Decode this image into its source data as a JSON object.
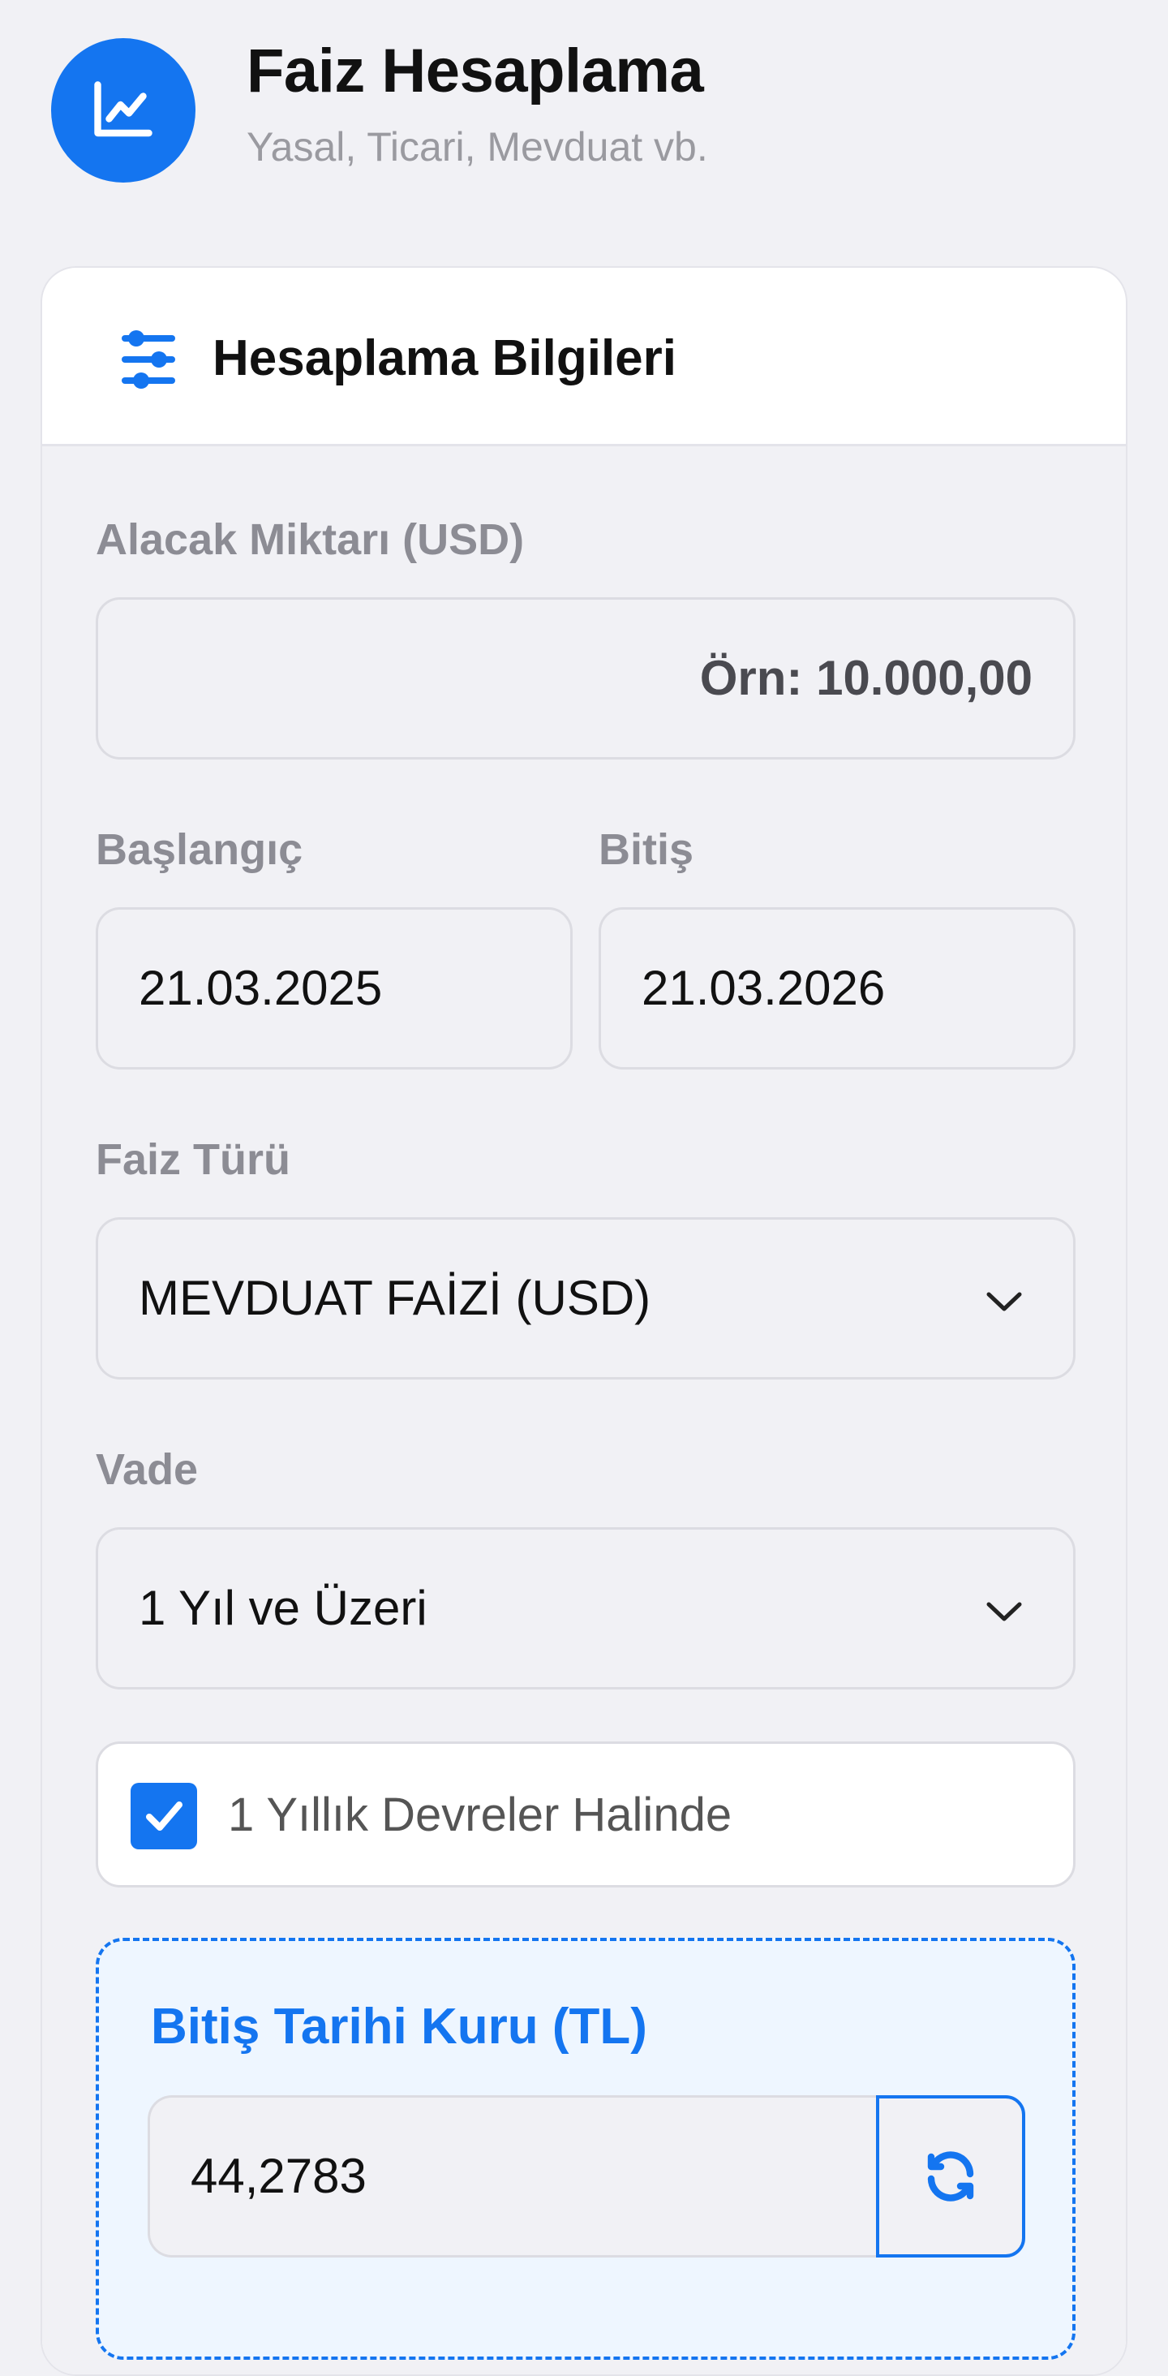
{
  "header": {
    "title": "Faiz Hesaplama",
    "subtitle": "Yasal, Ticari, Mevduat vb.",
    "logo_icon": "chart-line-icon"
  },
  "card": {
    "title": "Hesaplama Bilgileri",
    "header_icon": "sliders-icon"
  },
  "form": {
    "amount": {
      "label": "Alacak Miktarı (USD)",
      "value": "",
      "placeholder": "Örn: 10.000,00"
    },
    "start_date": {
      "label": "Başlangıç",
      "value": "21.03.2025"
    },
    "end_date": {
      "label": "Bitiş",
      "value": "21.03.2026"
    },
    "interest_type": {
      "label": "Faiz Türü",
      "selected": "MEVDUAT FAİZİ (USD)"
    },
    "term": {
      "label": "Vade",
      "selected": "1 Yıl ve Üzeri"
    },
    "yearly_periods": {
      "label": "1 Yıllık Devreler Halinde",
      "checked": true
    },
    "exchange_rate": {
      "label": "Bitiş Tarihi Kuru (TL)",
      "value": "44,2783",
      "refresh_icon": "refresh-icon"
    }
  },
  "colors": {
    "accent": "#1475F0",
    "background": "#F1F1F5",
    "card": "#FFFFFF",
    "label": "#8C8C94",
    "panel": "#EEF6FF"
  }
}
